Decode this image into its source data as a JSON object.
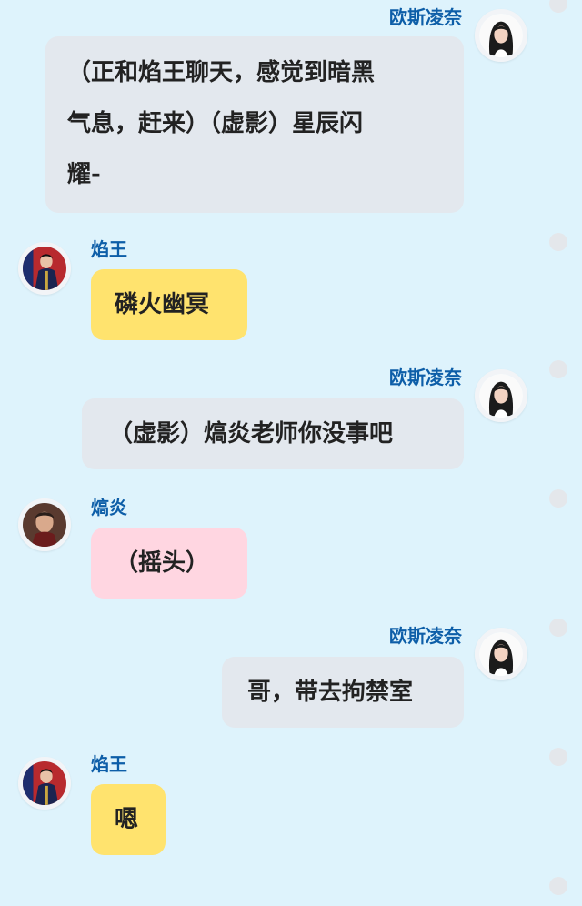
{
  "colors": {
    "background": "#def3fc",
    "name": "#0d5ea8",
    "bubble_gray": "#e3e8ee",
    "bubble_yellow": "#ffe36e",
    "bubble_pink": "#ffd6e1"
  },
  "messages": [
    {
      "sender": "欧斯凌奈",
      "side": "right",
      "bubble_color": "gray",
      "avatar": "long-black-hair-girl-avatar",
      "lines": [
        "（正和焰王聊天，感觉到暗黑",
        "气息，赶来）（虚影）星辰闪",
        "耀-"
      ]
    },
    {
      "sender": "焰王",
      "side": "left",
      "bubble_color": "yellow",
      "avatar": "young-man-red-background-avatar",
      "text": "磷火幽冥"
    },
    {
      "sender": "欧斯凌奈",
      "side": "right",
      "bubble_color": "gray",
      "avatar": "long-black-hair-girl-avatar",
      "text": "（虚影）熇炎老师你没事吧"
    },
    {
      "sender": "熇炎",
      "side": "left",
      "bubble_color": "pink",
      "avatar": "older-man-avatar",
      "text": "（摇头）"
    },
    {
      "sender": "欧斯凌奈",
      "side": "right",
      "bubble_color": "gray",
      "avatar": "long-black-hair-girl-avatar",
      "text": "哥，带去拘禁室"
    },
    {
      "sender": "焰王",
      "side": "left",
      "bubble_color": "yellow",
      "avatar": "young-man-red-background-avatar",
      "text": "嗯"
    }
  ]
}
